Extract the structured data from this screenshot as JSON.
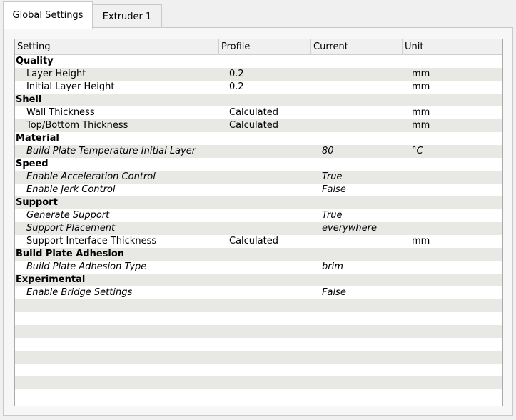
{
  "tabs": [
    {
      "label": "Global Settings",
      "active": true
    },
    {
      "label": "Extruder 1",
      "active": false
    }
  ],
  "table": {
    "columns": [
      "Setting",
      "Profile",
      "Current",
      "Unit"
    ],
    "rows": [
      {
        "type": "category",
        "label": "Quality"
      },
      {
        "type": "setting",
        "name": "Layer Height",
        "profile": "0.2",
        "current": "",
        "unit": "mm",
        "italic": false
      },
      {
        "type": "setting",
        "name": "Initial Layer Height",
        "profile": "0.2",
        "current": "",
        "unit": "mm",
        "italic": false
      },
      {
        "type": "category",
        "label": "Shell"
      },
      {
        "type": "setting",
        "name": "Wall Thickness",
        "profile": "Calculated",
        "current": "",
        "unit": "mm",
        "italic": false
      },
      {
        "type": "setting",
        "name": "Top/Bottom Thickness",
        "profile": "Calculated",
        "current": "",
        "unit": "mm",
        "italic": false
      },
      {
        "type": "category",
        "label": "Material"
      },
      {
        "type": "setting",
        "name": "Build Plate Temperature Initial Layer",
        "profile": "",
        "current": "80",
        "unit": "°C",
        "italic": true
      },
      {
        "type": "category",
        "label": "Speed"
      },
      {
        "type": "setting",
        "name": "Enable Acceleration Control",
        "profile": "",
        "current": "True",
        "unit": "",
        "italic": true
      },
      {
        "type": "setting",
        "name": "Enable Jerk Control",
        "profile": "",
        "current": "False",
        "unit": "",
        "italic": true
      },
      {
        "type": "category",
        "label": "Support"
      },
      {
        "type": "setting",
        "name": "Generate Support",
        "profile": "",
        "current": "True",
        "unit": "",
        "italic": true
      },
      {
        "type": "setting",
        "name": "Support Placement",
        "profile": "",
        "current": "everywhere",
        "unit": "",
        "italic": true
      },
      {
        "type": "setting",
        "name": "Support Interface Thickness",
        "profile": "Calculated",
        "current": "",
        "unit": "mm",
        "italic": false
      },
      {
        "type": "category",
        "label": "Build Plate Adhesion"
      },
      {
        "type": "setting",
        "name": "Build Plate Adhesion Type",
        "profile": "",
        "current": "brim",
        "unit": "",
        "italic": true
      },
      {
        "type": "category",
        "label": "Experimental"
      },
      {
        "type": "setting",
        "name": "Enable Bridge Settings",
        "profile": "",
        "current": "False",
        "unit": "",
        "italic": true
      }
    ]
  }
}
